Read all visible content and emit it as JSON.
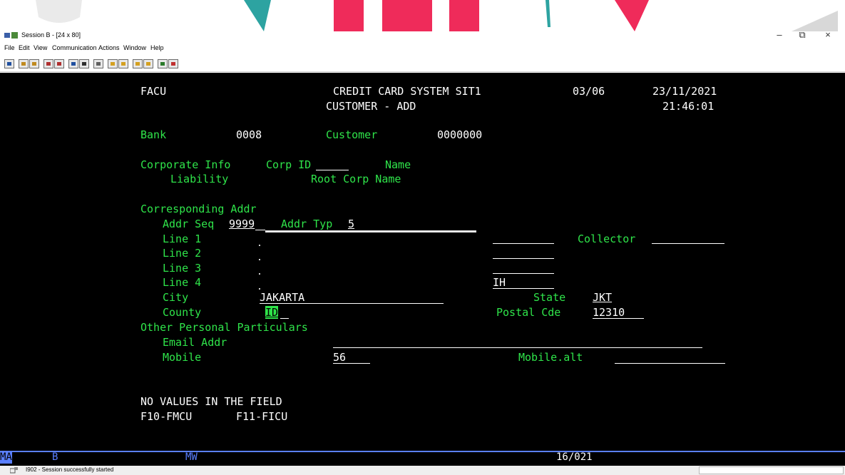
{
  "window": {
    "title": "Session B - [24 x 80]",
    "controls": {
      "minimize": "–",
      "restore": "⧉",
      "close": "×"
    }
  },
  "menu": [
    "File",
    "Edit",
    "View",
    "Communication",
    "Actions",
    "Window",
    "Help"
  ],
  "toolbar_icons": [
    "print-screen-icon",
    "copy-icon",
    "paste-icon",
    "send-file-icon",
    "receive-file-icon",
    "display-icon",
    "keyboard-icon",
    "macro-icon",
    "play-macro-icon",
    "record-macro-icon",
    "record-stop-icon",
    "paste-macro-icon",
    "color-icon",
    "help-icon"
  ],
  "screen": {
    "program_id": "FACU",
    "system_title": "CREDIT CARD SYSTEM SIT1",
    "page": "03/06",
    "date": "23/11/2021",
    "screen_title": "CUSTOMER - ADD",
    "time": "21:46:01",
    "bank_label": "Bank",
    "bank_value": "0008",
    "customer_label": "Customer",
    "customer_value": "0000000",
    "corporate_info_label": "Corporate Info",
    "corp_id_label": "Corp ID",
    "corp_name_label": "Name",
    "liability_label": "Liability",
    "root_corp_name_label": "Root Corp Name",
    "corresponding_addr_label": "Corresponding Addr",
    "addr_seq_label": "Addr Seq",
    "addr_seq_value": "9999",
    "addr_typ_label": "Addr Typ",
    "addr_typ_value": "5",
    "line1_label": "Line 1",
    "line2_label": "Line 2",
    "line3_label": "Line 3",
    "line4_label": "Line 4",
    "line4_value": "IH",
    "collector_label": "Collector",
    "city_label": "City",
    "city_value": "JAKARTA",
    "state_label": "State",
    "state_value": "JKT",
    "county_label": "County",
    "county_value": "ID",
    "postal_label": "Postal Cde",
    "postal_value": "12310",
    "other_personal_label": "Other Personal Particulars",
    "email_label": "Email Addr",
    "mobile_label": "Mobile",
    "mobile_value": "56",
    "mobile_alt_label": "Mobile.alt",
    "message": "NO VALUES IN THE FIELD",
    "fkey1": "F10-FMCU",
    "fkey2": "F11-FICU"
  },
  "oia": {
    "ma": "MA",
    "session": "B",
    "mw": "MW",
    "cursor_pos": "16/021"
  },
  "statusbar": {
    "message": "I902 - Session successfully started"
  },
  "colors": {
    "terminal_bg": "#000000",
    "terminal_green": "#2fe44a",
    "terminal_white": "#ffffff",
    "oia_accent": "#5a7fff"
  }
}
